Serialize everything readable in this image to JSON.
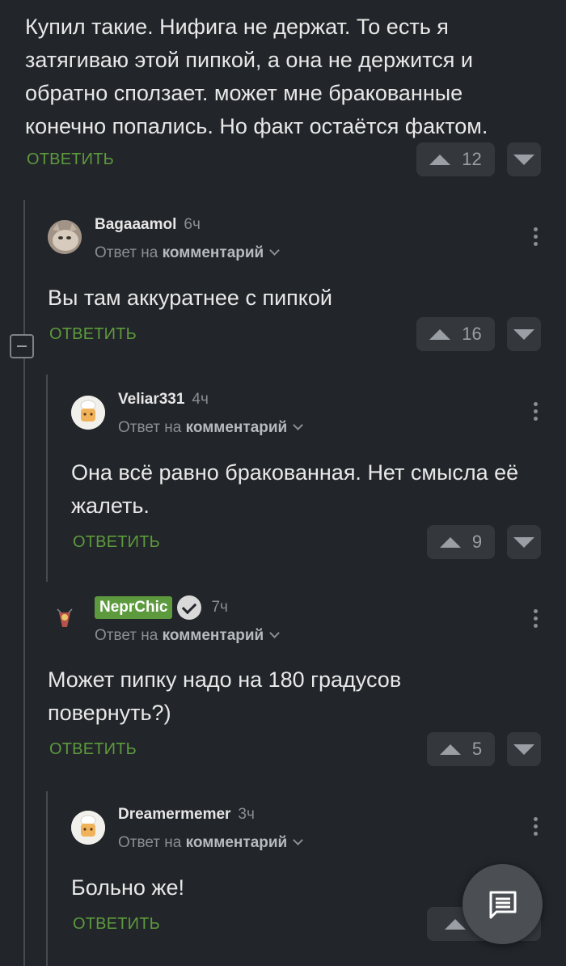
{
  "reply_label": "ОТВЕТИТЬ",
  "reply_prefix": "Ответ на",
  "reply_target": "комментарий",
  "top_comment": {
    "text": "Купил такие. Нифига не держат. То есть я затягиваю этой пипкой, а она не держится и обратно сползает. может мне бракованные конечно попались. Но факт остаётся фактом.",
    "votes": "12"
  },
  "comments": [
    {
      "user": "Bagaaamol",
      "time": "6ч",
      "text": "Вы там аккуратнее с пипкой",
      "votes": "16"
    },
    {
      "user": "Veliar331",
      "time": "4ч",
      "text": "Она всё равно бракованная. Нет смысла её жалеть.",
      "votes": "9"
    },
    {
      "user": "NeprChic",
      "time": "7ч",
      "text": "Может пипку надо на 180 градусов повернуть?)",
      "votes": "5"
    },
    {
      "user": "Dreamermemer",
      "time": "3ч",
      "text": "Больно же!",
      "votes": ""
    }
  ],
  "icons": {
    "collapse": "minus-square-icon",
    "more": "vertical-dots-icon",
    "verified": "check-circle-icon",
    "fab": "chat-icon"
  },
  "colors": {
    "background": "#222529",
    "accent": "#5d9a3e",
    "vote_bg": "#34383d"
  }
}
